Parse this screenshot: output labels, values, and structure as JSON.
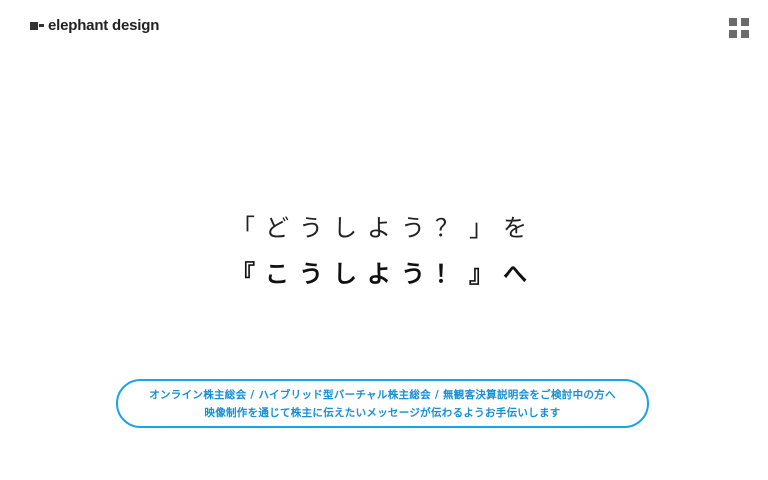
{
  "header": {
    "logo_text": "elephant design",
    "menu_icon": "grid-menu-icon"
  },
  "hero": {
    "line1": "「どうしよう？」を",
    "line2": "『こうしよう！』へ"
  },
  "services": {
    "line1": "オンライン株主総会 / ハイブリッド型バーチャル株主総会 / 無観客決算説明会をご検討中の方へ",
    "line2": "映像制作を通じて株主に伝えたいメッセージが伝わるようお手伝いします"
  },
  "colors": {
    "accent": "#1aa3e8",
    "text": "#222222",
    "icon": "#6b6b6b"
  }
}
